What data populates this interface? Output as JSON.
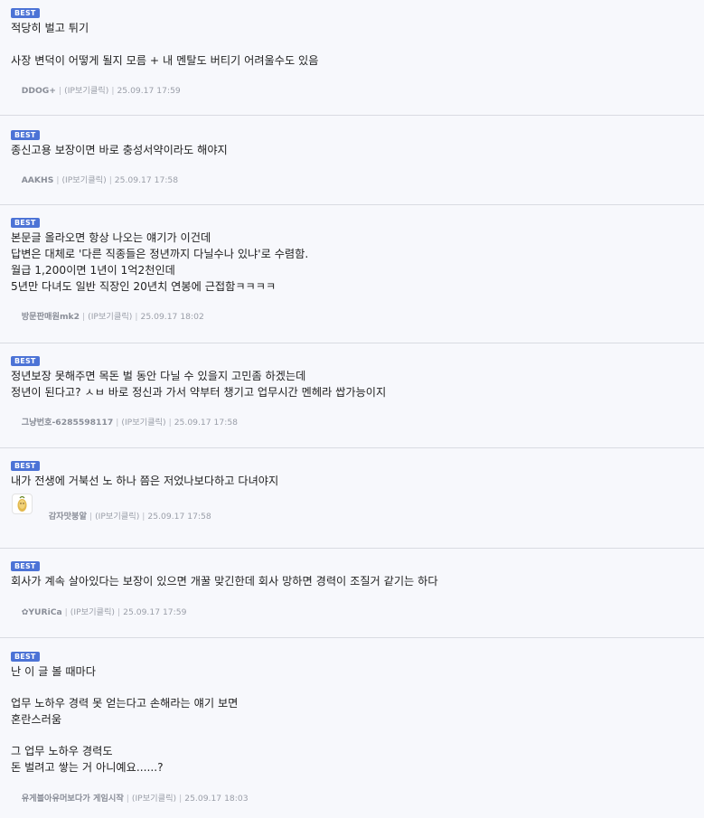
{
  "comments": [
    {
      "badge": "BEST",
      "lines": [
        "적당히 벌고 튀기",
        "",
        "사장 변덕이 어떻게 될지 모름 + 내 멘탈도 버티기 어려울수도 있음"
      ],
      "author": "DDOG+",
      "ip": "(IP보기클릭)",
      "date": "25.09.17 17:59"
    },
    {
      "badge": "BEST",
      "lines": [
        "종신고용 보장이면 바로 충성서약이라도 해야지"
      ],
      "author": "AAKHS",
      "ip": "(IP보기클릭)",
      "date": "25.09.17 17:58"
    },
    {
      "badge": "BEST",
      "lines": [
        "본문글 올라오면 항상 나오는 얘기가 이건데",
        "답변은 대체로 '다른 직종들은 정년까지 다닐수나 있냐'로 수렴함.",
        "월급 1,200이면 1년이 1억2천인데",
        "5년만 다녀도 일반 직장인 20년치 연봉에 근접함ㅋㅋㅋㅋ"
      ],
      "author": "방문판매원mk2",
      "ip": "(IP보기클릭)",
      "date": "25.09.17 18:02"
    },
    {
      "badge": "BEST",
      "lines": [
        "정년보장 못해주면 목돈 벌 동안 다닐 수 있을지 고민좀 하겠는데",
        "정년이 된다고? ㅅㅂ 바로 정신과 가서 약부터 챙기고 업무시간 멘헤라 쌉가능이지"
      ],
      "author": "그냥번호-6285598117",
      "ip": "(IP보기클릭)",
      "date": "25.09.17 17:58"
    },
    {
      "badge": "BEST",
      "lines": [
        "내가 전생에 거북선 노 하나 쯤은 저었나보다하고 다녀야지"
      ],
      "author": "감자맛붕알",
      "ip": "(IP보기클릭)",
      "date": "25.09.17 17:58",
      "avatar": "potato-avatar"
    },
    {
      "badge": "BEST",
      "lines": [
        "회사가 계속 살아있다는 보장이 있으면 개꿀 맞긴한데 회사 망하면 경력이 조질거 같기는 하다"
      ],
      "author": "✿YURiCa",
      "ip": "(IP보기클릭)",
      "date": "25.09.17 17:59"
    },
    {
      "badge": "BEST",
      "lines": [
        "난 이 글 볼 때마다",
        "",
        "업무 노하우 경력 못 얻는다고 손해라는 얘기 보면",
        "혼란스러움",
        "",
        "그 업무 노하우 경력도",
        "돈 벌려고 쌓는 거 아니예요......?"
      ],
      "author": "유게블아유머보다가 게임시작",
      "ip": "(IP보기클릭)",
      "date": "25.09.17 18:03"
    }
  ]
}
